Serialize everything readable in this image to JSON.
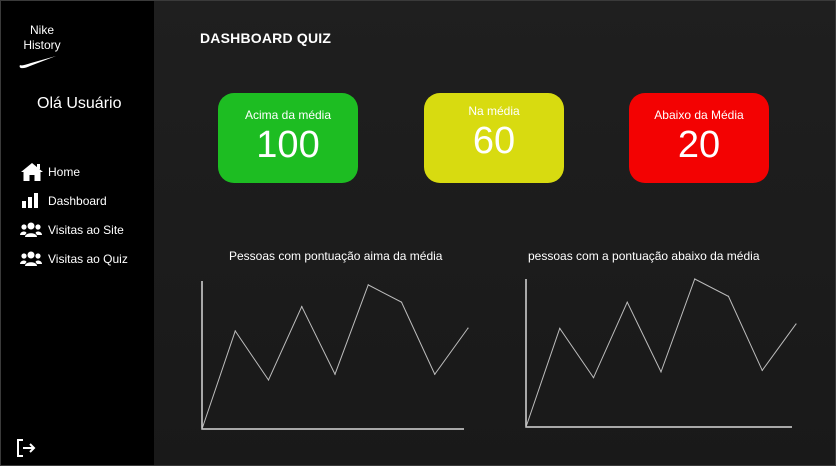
{
  "sidebar": {
    "brand_line1": "Nike",
    "brand_line2": "History",
    "greeting": "Olá Usuário",
    "items": [
      {
        "label": "Home",
        "icon": "home-icon"
      },
      {
        "label": "Dashboard",
        "icon": "bar-chart-icon"
      },
      {
        "label": "Visitas ao Site",
        "icon": "users-icon"
      },
      {
        "label": "Visitas ao Quiz",
        "icon": "users-icon"
      }
    ],
    "logout_icon": "logout-icon"
  },
  "main": {
    "title": "DASHBOARD QUIZ",
    "cards": [
      {
        "label": "Acima da média",
        "value": "100",
        "color": "#1dbd22"
      },
      {
        "label": "Na média",
        "value": "60",
        "color": "#d8db10"
      },
      {
        "label": "Abaixo da Média",
        "value": "20",
        "color": "#f30202"
      }
    ]
  },
  "chart_data": [
    {
      "type": "line",
      "title": "Pessoas  com pontuação aima da média",
      "x": [
        0,
        1,
        2,
        3,
        4,
        5,
        6,
        7,
        8
      ],
      "values": [
        0,
        68,
        34,
        85,
        38,
        100,
        88,
        38,
        70
      ]
    },
    {
      "type": "line",
      "title": "pessoas com a pontuação abaixo da média",
      "x": [
        0,
        1,
        2,
        3,
        4,
        5,
        6,
        7,
        8
      ],
      "values": [
        0,
        68,
        34,
        86,
        38,
        102,
        90,
        39,
        71
      ]
    }
  ]
}
